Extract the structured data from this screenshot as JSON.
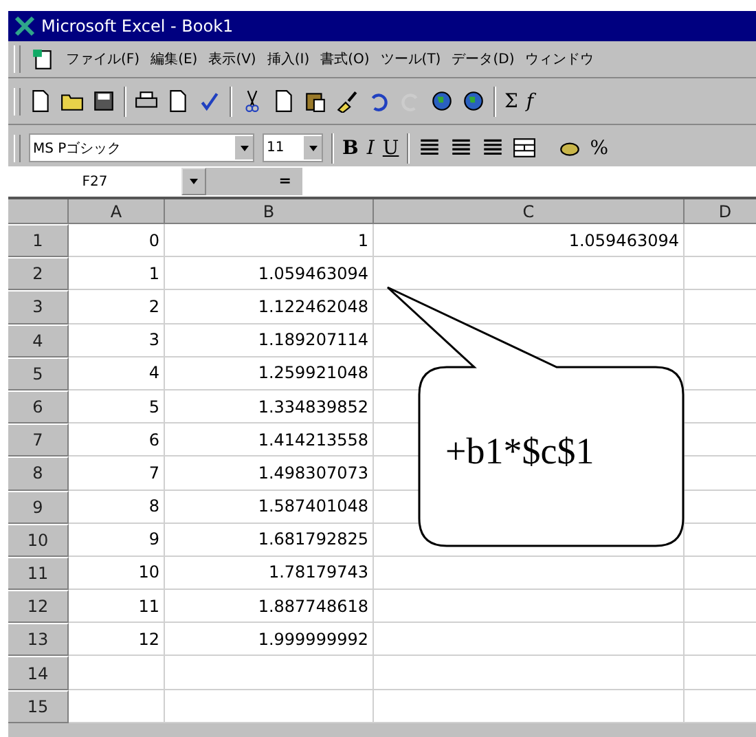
{
  "window": {
    "title": "Microsoft Excel - Book1"
  },
  "menu": [
    "ファイル(F)",
    "編集(E)",
    "表示(V)",
    "挿入(I)",
    "書式(O)",
    "ツール(T)",
    "データ(D)",
    "ウィンドウ"
  ],
  "toolbar": {
    "sum": "Σ",
    "function": "f"
  },
  "format_bar": {
    "font": "MS Pゴシック",
    "size": "11",
    "bold": "B",
    "italic": "I",
    "underline": "U",
    "percent": "%"
  },
  "formula_bar": {
    "name_box": "F27",
    "equals": "="
  },
  "columns": [
    "A",
    "B",
    "C",
    "D"
  ],
  "rows": [
    {
      "header": "1",
      "cells": [
        "0",
        "1",
        "1.059463094"
      ]
    },
    {
      "header": "2",
      "cells": [
        "1",
        "1.059463094",
        ""
      ]
    },
    {
      "header": "3",
      "cells": [
        "2",
        "1.122462048",
        ""
      ]
    },
    {
      "header": "4",
      "cells": [
        "3",
        "1.189207114",
        ""
      ]
    },
    {
      "header": "5",
      "cells": [
        "4",
        "1.259921048",
        ""
      ]
    },
    {
      "header": "6",
      "cells": [
        "5",
        "1.334839852",
        ""
      ]
    },
    {
      "header": "7",
      "cells": [
        "6",
        "1.414213558",
        ""
      ]
    },
    {
      "header": "8",
      "cells": [
        "7",
        "1.498307073",
        ""
      ]
    },
    {
      "header": "9",
      "cells": [
        "8",
        "1.587401048",
        ""
      ]
    },
    {
      "header": "10",
      "cells": [
        "9",
        "1.681792825",
        ""
      ]
    },
    {
      "header": "11",
      "cells": [
        "10",
        "1.78179743",
        ""
      ]
    },
    {
      "header": "12",
      "cells": [
        "11",
        "1.887748618",
        ""
      ]
    },
    {
      "header": "13",
      "cells": [
        "12",
        "1.999999992",
        ""
      ]
    },
    {
      "header": "14",
      "cells": [
        "",
        "",
        ""
      ]
    },
    {
      "header": "15",
      "cells": [
        "",
        "",
        ""
      ]
    }
  ],
  "callout": {
    "text": "+b1*$c$1"
  }
}
